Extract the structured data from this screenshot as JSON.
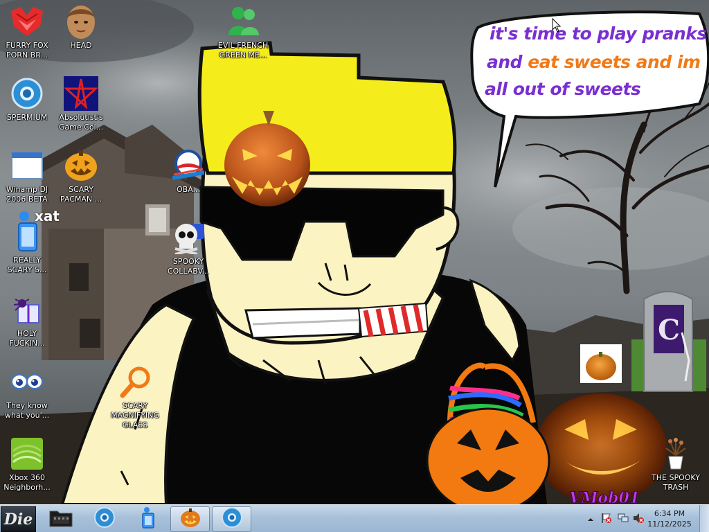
{
  "bubble": {
    "line1": "it's time to play pranks",
    "line2a": "and ",
    "line2b": "eat sweets and im",
    "line3": "all out of sweets",
    "color_purple": "#7a2fd0",
    "color_orange": "#f07a18"
  },
  "desktop_icons": {
    "furry_fox": {
      "label": "FURRY FOX PORN BR...",
      "icon": "red-fox-logo-icon"
    },
    "head": {
      "label": "HEAD",
      "icon": "avatar-head-icon"
    },
    "evil_french": {
      "label": "EVIL FRENCH GREEN ME...",
      "icon": "messenger-buddies-icon"
    },
    "spermium": {
      "label": "SPERMIUM",
      "icon": "chrome-like-browser-icon"
    },
    "absolutist": {
      "label": "Absolutist's Game Col...",
      "icon": "pentagram-star-icon"
    },
    "winamp": {
      "label": "Winamp DJ 2006 BETA",
      "icon": "window-app-icon"
    },
    "scary_pacman": {
      "label": "SCARY PACMAN ...",
      "icon": "jack-o-lantern-icon"
    },
    "obama": {
      "label": "OBA...",
      "icon": "obama-logo-icon"
    },
    "really_scary": {
      "label": "REALLY SCARY S...",
      "icon": "xat-bottle-icon",
      "badge": "xat"
    },
    "spooky_collab": {
      "label": "SPOOKY COLLABV...",
      "icon": "skull-icon"
    },
    "holy_fuckin": {
      "label": "HOLY FUCKIN...",
      "icon": "spider-gift-icon"
    },
    "they_know": {
      "label": "They know what you'...",
      "icon": "staring-eyes-icon"
    },
    "scary_magnifying": {
      "label": "SCARY MAGNIFYING GLASS",
      "icon": "magnifying-glass-icon"
    },
    "xbox": {
      "label": "Xbox 360 Neighborh...",
      "icon": "xbox-icon"
    },
    "spooky_trash": {
      "label": "THE SPOOKY TRASH",
      "icon": "plant-pot-trash-icon"
    }
  },
  "wallpaper": {
    "watermark": "VMob01"
  },
  "taskbar": {
    "start_label": "Die",
    "items": [
      {
        "name": "film-folder-icon",
        "active": false
      },
      {
        "name": "browser-icon",
        "active": false
      },
      {
        "name": "usb-drive-icon",
        "active": false
      },
      {
        "name": "pumpkin-icon",
        "active": true
      },
      {
        "name": "browser-icon",
        "active": true
      }
    ],
    "clock_time": "6:34 PM",
    "clock_date": "11/12/2025"
  },
  "colors": {
    "hat_yellow": "#f5ec1c",
    "skin": "#fbf3c2",
    "pumpkin_orange": "#f27a11",
    "taskbar_blue": "#a8c1da"
  }
}
